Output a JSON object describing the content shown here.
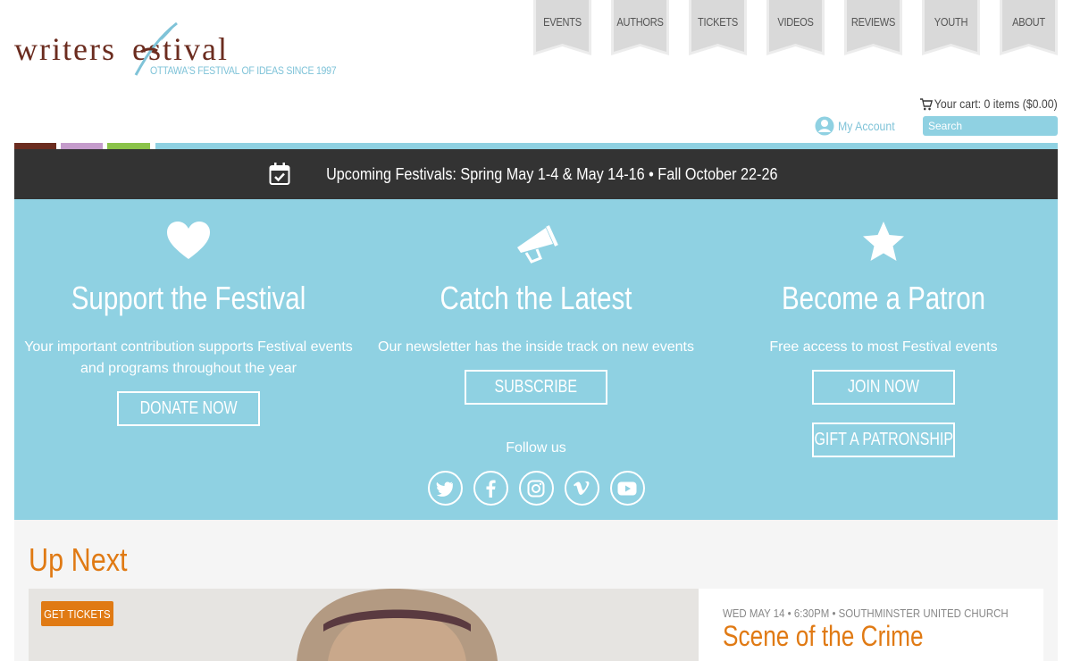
{
  "logo": {
    "text": "writersfestival",
    "tagline": "OTTAWA'S FESTIVAL OF IDEAS SINCE 1997"
  },
  "nav": [
    "EVENTS",
    "AUTHORS",
    "TICKETS",
    "VIDEOS",
    "REVIEWS",
    "YOUTH",
    "ABOUT"
  ],
  "cart": {
    "label": "Your cart: 0 items ($0.00)",
    "icon": "cart-icon"
  },
  "account": {
    "label": "My Account",
    "icon": "user-circle-icon"
  },
  "search": {
    "placeholder": "Search"
  },
  "color_tabs": [
    "#6b2c1f",
    "#c49bcb",
    "#8bc34a",
    "#8fd1e2"
  ],
  "banner": {
    "icon": "calendar-check-icon",
    "text": "Upcoming Festivals: Spring May 1-4 & May 14-16 • Fall October 22-26"
  },
  "columns": [
    {
      "icon": "heart-icon",
      "title": "Support the Festival",
      "desc": "Your important contribution supports Festival events and programs throughout the year",
      "buttons": [
        "DONATE NOW"
      ]
    },
    {
      "icon": "megaphone-icon",
      "title": "Catch the Latest",
      "desc": "Our newsletter has the inside track on new events",
      "buttons": [
        "SUBSCRIBE"
      ],
      "follow_label": "Follow us",
      "socials": [
        "twitter-icon",
        "facebook-icon",
        "instagram-icon",
        "vimeo-icon",
        "youtube-icon"
      ]
    },
    {
      "icon": "star-icon",
      "title": "Become a Patron",
      "desc": "Free access to most Festival events",
      "buttons": [
        "JOIN NOW",
        "GIFT A PATRONSHIP"
      ]
    }
  ],
  "up_next": {
    "title": "Up Next",
    "ticket_button": "GET TICKETS",
    "event": {
      "meta": "WED MAY 14 • 6:30PM • SOUTHMINSTER UNITED CHURCH",
      "title": "Scene of the Crime"
    }
  },
  "colors": {
    "panel": "#8fd1e2",
    "banner": "#333333",
    "accent_orange": "#e07a14",
    "logo_brown": "#6b2c1f",
    "tagline_blue": "#7fc3d8"
  }
}
